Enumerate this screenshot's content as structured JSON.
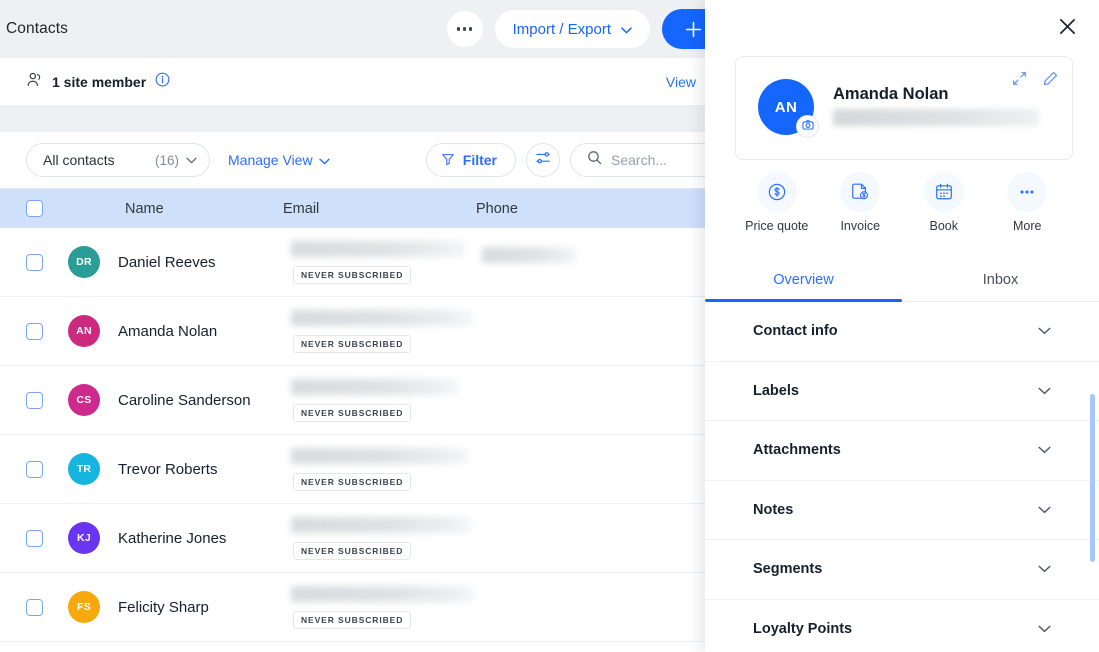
{
  "topbar": {
    "title": "Contacts",
    "ellipsis_label": "More options",
    "import_export_label": "Import / Export",
    "add_label": "+"
  },
  "member_bar": {
    "text": "1 site member",
    "info_label": "i",
    "view_label": "View"
  },
  "toolbar": {
    "view_name": "All contacts",
    "view_count": "(16)",
    "manage_view_label": "Manage View",
    "filter_label": "Filter",
    "settings_label": "Display settings",
    "search_placeholder": "Search...",
    "search_value": ""
  },
  "table": {
    "columns": [
      "Name",
      "Email",
      "Phone"
    ],
    "badge_label": "NEVER SUBSCRIBED",
    "rows": [
      {
        "initials": "DR",
        "name": "Daniel Reeves",
        "color": "#2a9d96",
        "badge": "NEVER SUBSCRIBED",
        "email_w": 175,
        "phone_w": 95
      },
      {
        "initials": "AN",
        "name": "Amanda Nolan",
        "color": "#cc2a7e",
        "badge": "NEVER SUBSCRIBED",
        "email_w": 182,
        "phone_w": 0
      },
      {
        "initials": "CS",
        "name": "Caroline Sanderson",
        "color": "#cc2a8c",
        "badge": "NEVER SUBSCRIBED",
        "email_w": 168,
        "phone_w": 0
      },
      {
        "initials": "TR",
        "name": "Trevor Roberts",
        "color": "#16b5e0",
        "badge": "NEVER SUBSCRIBED",
        "email_w": 178,
        "phone_w": 0
      },
      {
        "initials": "KJ",
        "name": "Katherine Jones",
        "color": "#6a35f0",
        "badge": "NEVER SUBSCRIBED",
        "email_w": 180,
        "phone_w": 0
      },
      {
        "initials": "FS",
        "name": "Felicity Sharp",
        "color": "#f7a80d",
        "badge": "NEVER SUBSCRIBED",
        "email_w": 184,
        "phone_w": 0
      }
    ]
  },
  "panel": {
    "close_label": "×",
    "contact": {
      "initials": "AN",
      "name": "Amanda Nolan",
      "expand_label": "Expand",
      "edit_label": "Edit",
      "photo_label": "Change photo"
    },
    "actions": [
      {
        "label": "Price quote",
        "icon": "dollar-circle-icon"
      },
      {
        "label": "Invoice",
        "icon": "invoice-icon"
      },
      {
        "label": "Book",
        "icon": "calendar-icon"
      },
      {
        "label": "More",
        "icon": "ellipsis-icon"
      }
    ],
    "tabs": [
      {
        "label": "Overview",
        "active": true
      },
      {
        "label": "Inbox",
        "active": false
      }
    ],
    "sections": [
      {
        "label": "Contact info"
      },
      {
        "label": "Labels"
      },
      {
        "label": "Attachments"
      },
      {
        "label": "Notes"
      },
      {
        "label": "Segments"
      },
      {
        "label": "Loyalty Points"
      }
    ]
  },
  "colors": {
    "accent": "#1565ff",
    "link": "#2a6fff",
    "header_row": "#cfe0fa",
    "topbar_bg": "#eef1f4"
  }
}
